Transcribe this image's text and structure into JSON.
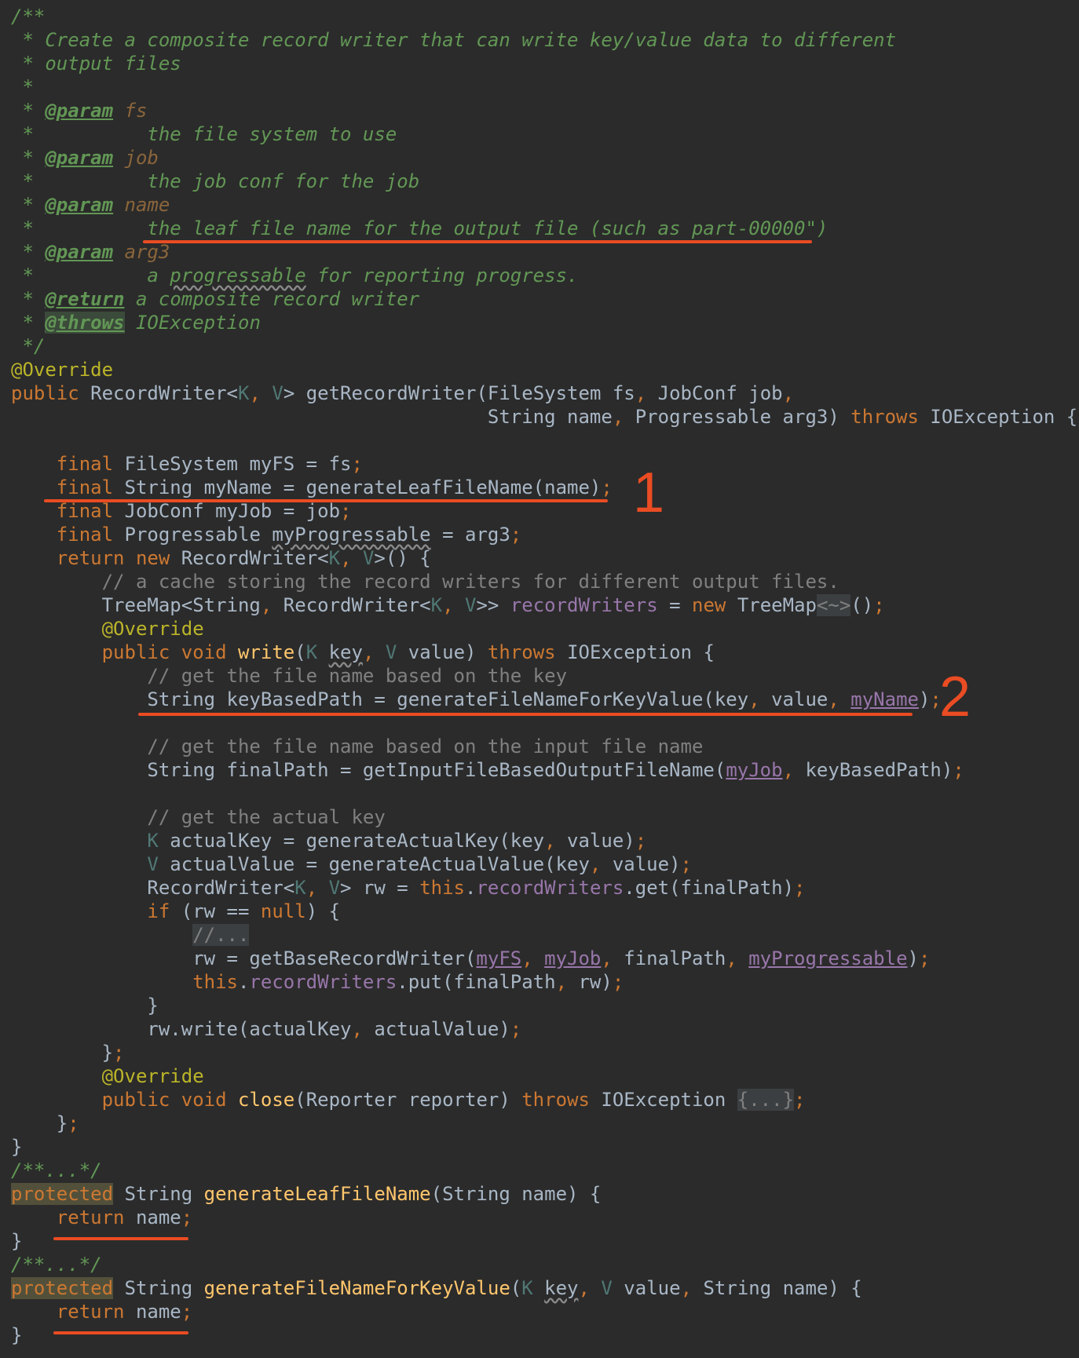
{
  "lines": [
    "/**",
    " * Create a composite record writer that can write key/value data to different",
    " * output files",
    " *",
    " * @param fs",
    " *          the file system to use",
    " * @param job",
    " *          the job conf for the job",
    " * @param name",
    " *          the leaf file name for the output file (such as part-00000\")",
    " * @param arg3",
    " *          a progressable for reporting progress.",
    " * @return a composite record writer",
    " * @throws IOException",
    " */",
    "@Override",
    "public RecordWriter<K, V> getRecordWriter(FileSystem fs, JobConf job,",
    "                                          String name, Progressable arg3) throws IOException {",
    "",
    "    final FileSystem myFS = fs;",
    "    final String myName = generateLeafFileName(name);",
    "    final JobConf myJob = job;",
    "    final Progressable myProgressable = arg3;",
    "    return new RecordWriter<K, V>() {",
    "        // a cache storing the record writers for different output files.",
    "        TreeMap<String, RecordWriter<K, V>> recordWriters = new TreeMap<~>();",
    "        @Override",
    "        public void write(K key, V value) throws IOException {",
    "            // get the file name based on the key",
    "            String keyBasedPath = generateFileNameForKeyValue(key, value, myName);",
    "",
    "            // get the file name based on the input file name",
    "            String finalPath = getInputFileBasedOutputFileName(myJob, keyBasedPath);",
    "",
    "            // get the actual key",
    "            K actualKey = generateActualKey(key, value);",
    "            V actualValue = generateActualValue(key, value);",
    "            RecordWriter<K, V> rw = this.recordWriters.get(finalPath);",
    "            if (rw == null) {",
    "                //...",
    "                rw = getBaseRecordWriter(myFS, myJob, finalPath, myProgressable);",
    "                this.recordWriters.put(finalPath, rw);",
    "            }",
    "            rw.write(actualKey, actualValue);",
    "        };",
    "        @Override",
    "        public void close(Reporter reporter) throws IOException {...};",
    "    };",
    "}",
    "/**...*/",
    "protected String generateLeafFileName(String name) {",
    "    return name;",
    "}",
    "/**...*/",
    "protected String generateFileNameForKeyValue(K key, V value, String name) {",
    "    return name;",
    "}"
  ],
  "markers": [
    "1",
    "2"
  ],
  "colors": {
    "background": "#2b2b2b",
    "text": "#a9b7c6",
    "keyword": "#cc7832",
    "doc_comment": "#629755",
    "annotation": "#bbb529",
    "method": "#ffc66d",
    "field": "#9876aa",
    "type_param": "#507874",
    "comment": "#808080",
    "highlight_red": "#ea4c23"
  }
}
